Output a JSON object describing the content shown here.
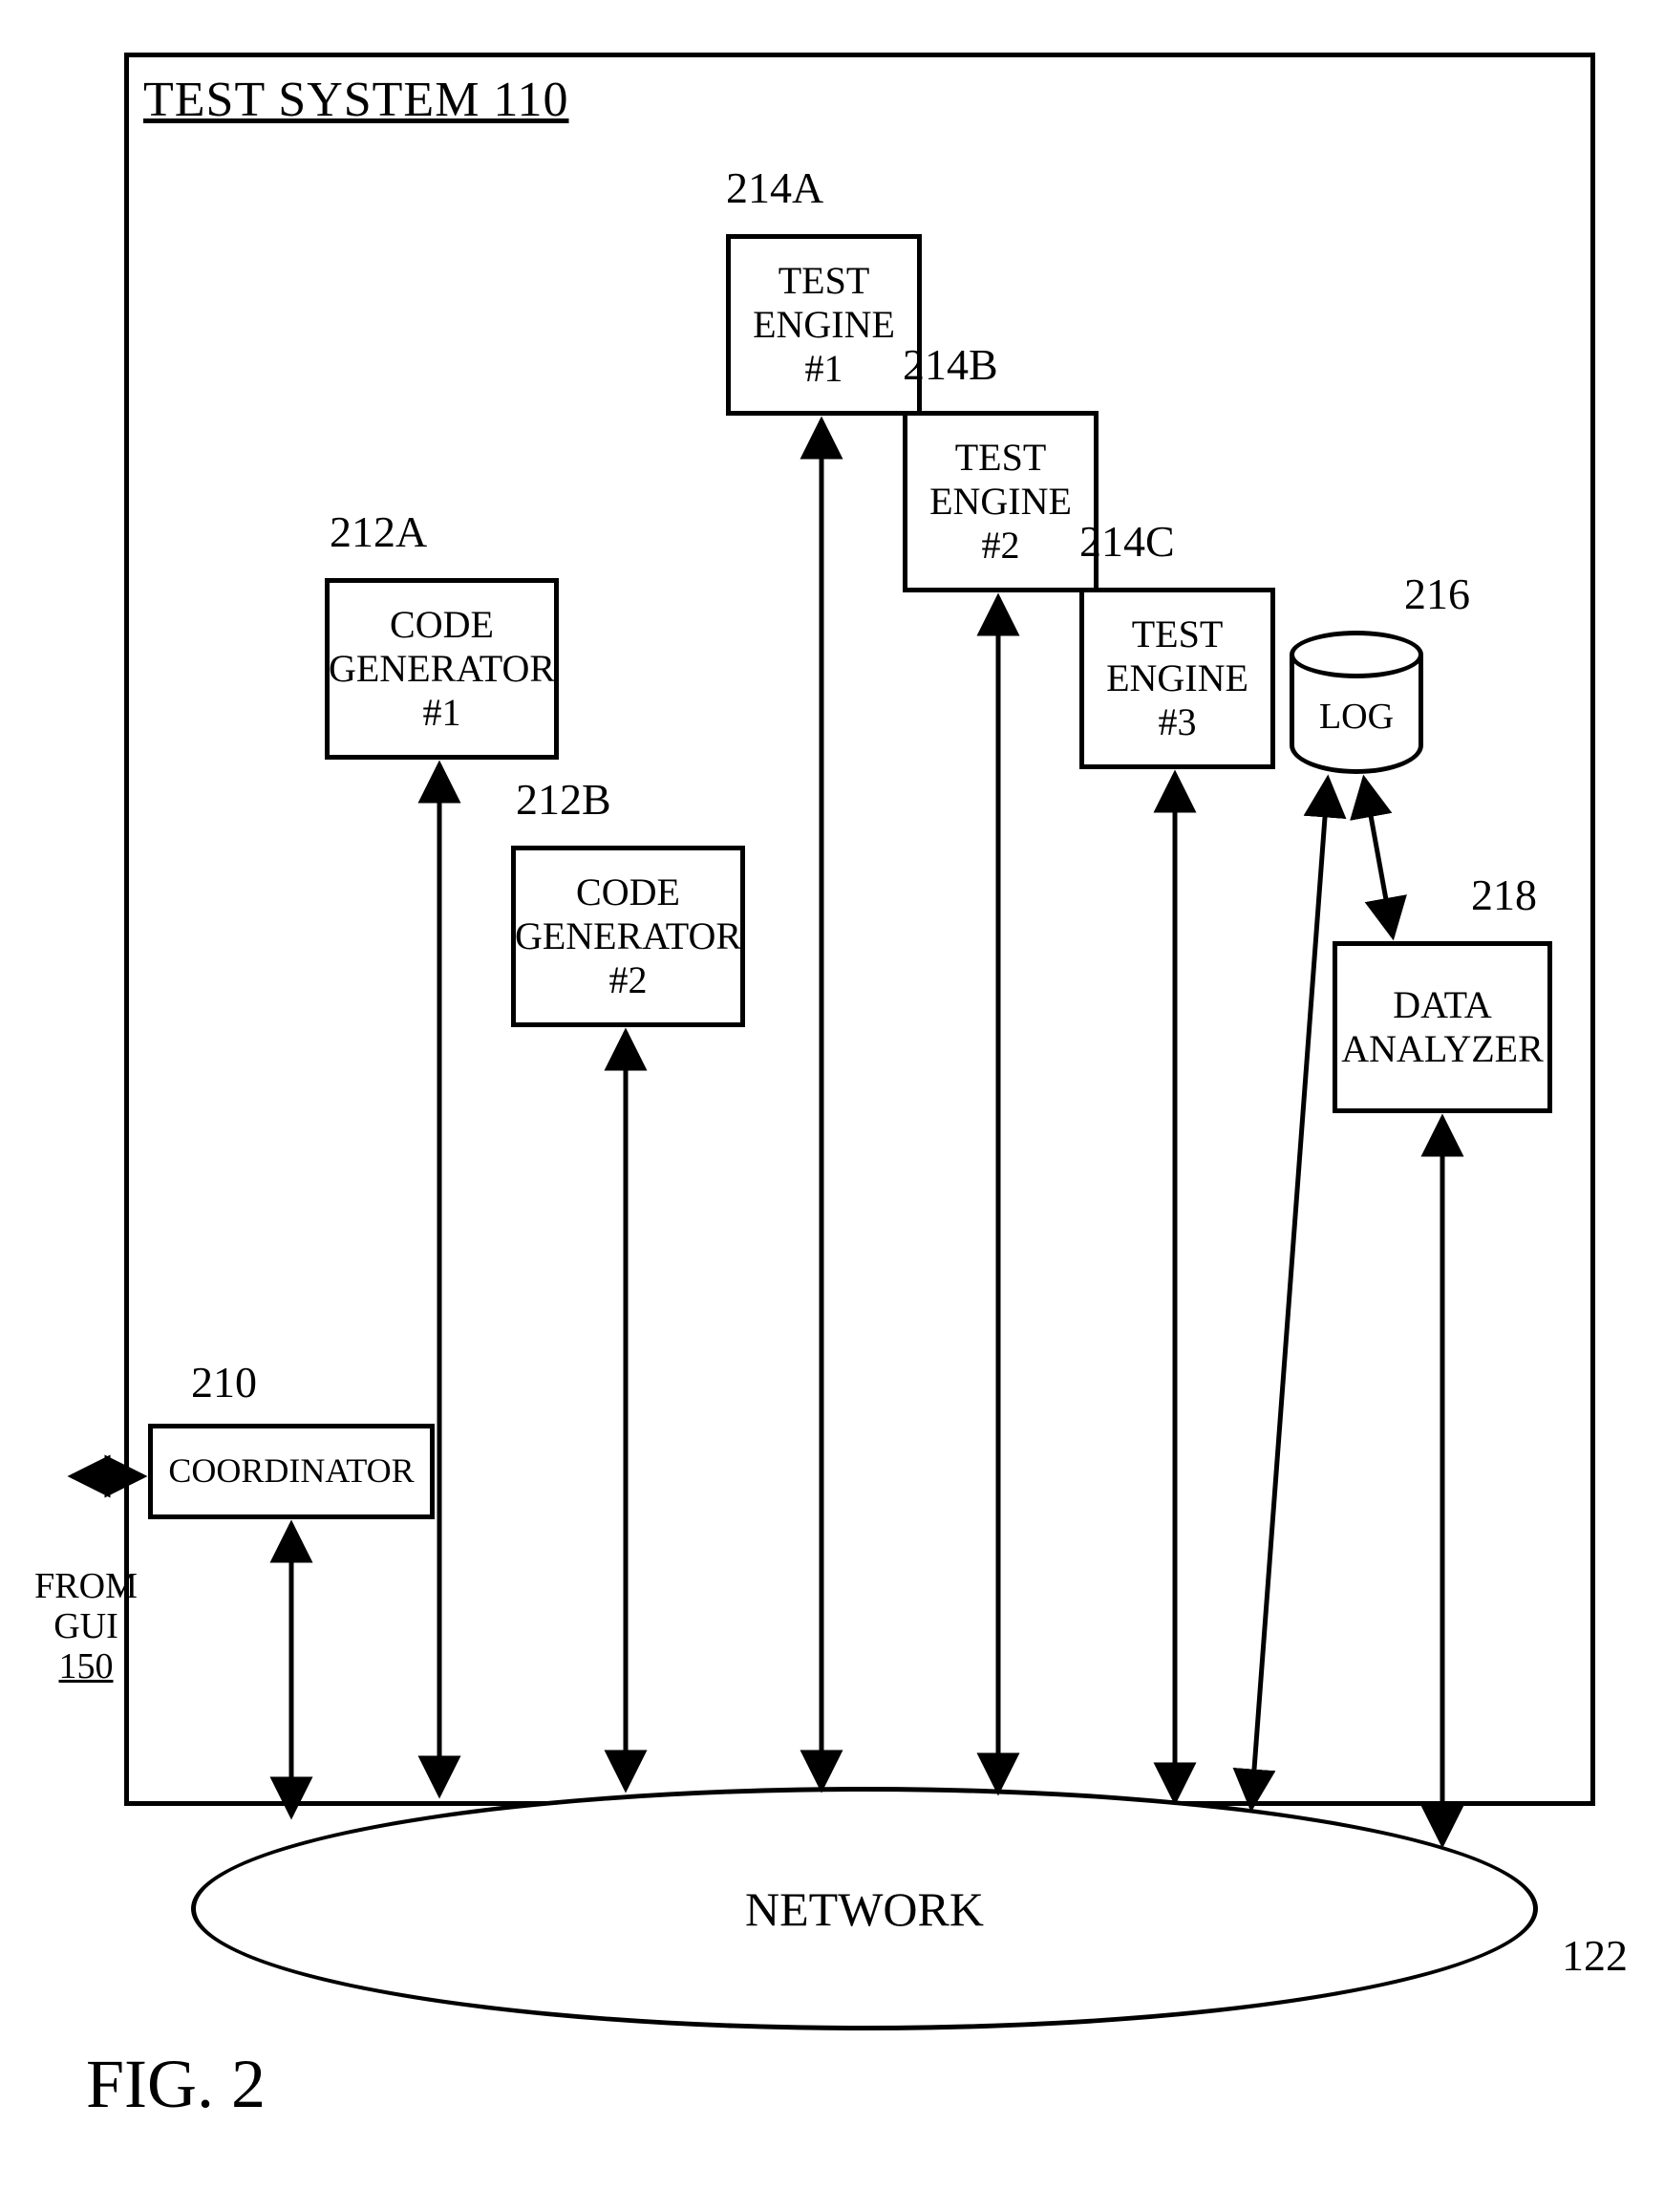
{
  "title": "TEST SYSTEM 110",
  "fromGui": {
    "line1": "FROM",
    "line2": "GUI",
    "line3": "150"
  },
  "coordinator": {
    "label": "COORDINATOR",
    "ref": "210"
  },
  "codeGen1": {
    "line1": "CODE",
    "line2": "GENERATOR",
    "line3": "#1",
    "ref": "212A"
  },
  "codeGen2": {
    "line1": "CODE",
    "line2": "GENERATOR",
    "line3": "#2",
    "ref": "212B"
  },
  "testEng1": {
    "line1": "TEST",
    "line2": "ENGINE",
    "line3": "#1",
    "ref": "214A"
  },
  "testEng2": {
    "line1": "TEST",
    "line2": "ENGINE",
    "line3": "#2",
    "ref": "214B"
  },
  "testEng3": {
    "line1": "TEST",
    "line2": "ENGINE",
    "line3": "#3",
    "ref": "214C"
  },
  "log": {
    "label": "LOG",
    "ref": "216"
  },
  "dataAnalyzer": {
    "line1": "DATA",
    "line2": "ANALYZER",
    "ref": "218"
  },
  "network": {
    "label": "NETWORK",
    "ref": "122"
  },
  "figure": "FIG. 2"
}
